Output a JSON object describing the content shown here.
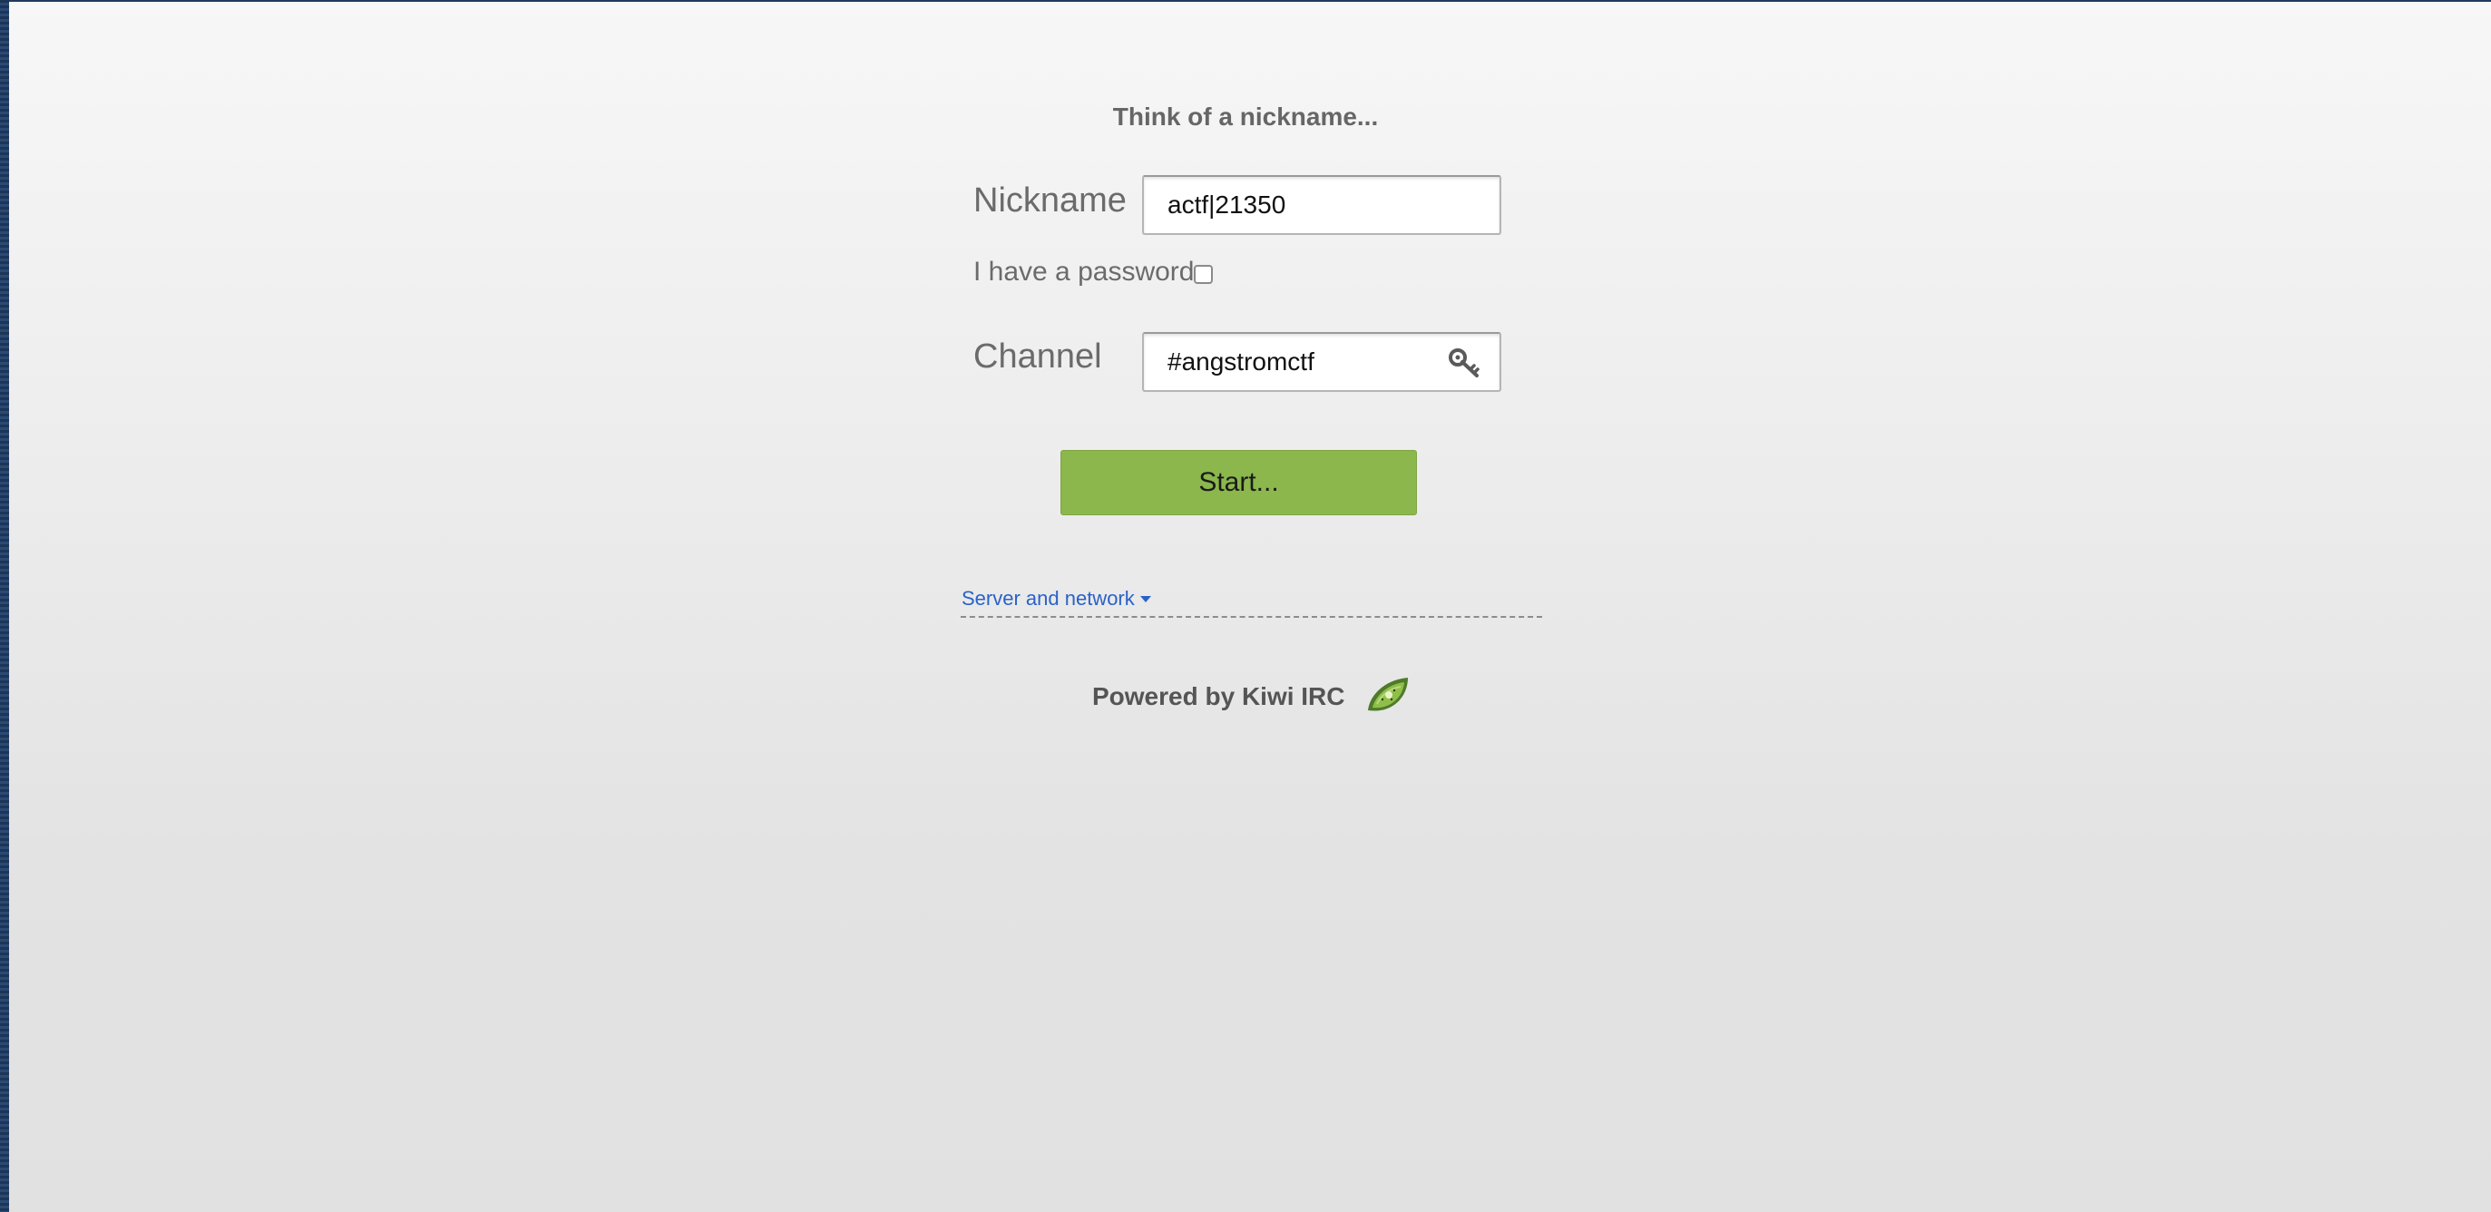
{
  "form": {
    "heading": "Think of a nickname...",
    "nickname_label": "Nickname",
    "nickname_value": "actf|21350",
    "password_label": "I have a password",
    "password_checked": false,
    "channel_label": "Channel",
    "channel_value": "#angstromctf",
    "start_label": "Start..."
  },
  "server_toggle": {
    "label": "Server and network",
    "icon": "caret-down-icon"
  },
  "footer": {
    "powered_by": "Powered by Kiwi IRC",
    "logo_icon": "kiwi-logo"
  },
  "colors": {
    "accent_button": "#8bb74c",
    "link": "#2a62c9",
    "frame_border": "#1f3a5f"
  }
}
